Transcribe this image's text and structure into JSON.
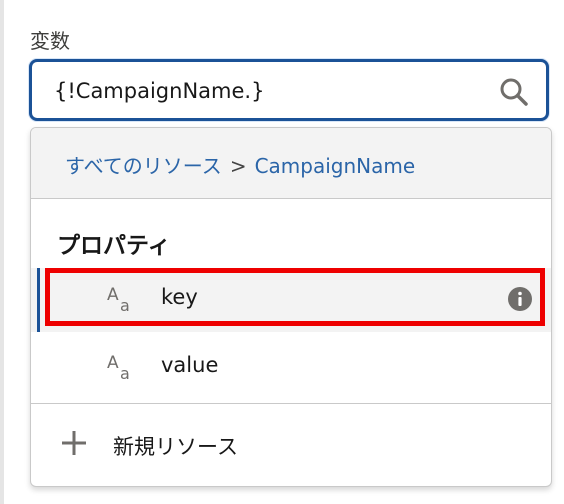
{
  "field": {
    "label": "変数",
    "value": "{!CampaignName.}"
  },
  "icons": {
    "search": "search-icon",
    "text_type": "text-type-icon",
    "info": "info-icon",
    "add": "plus-icon"
  },
  "breadcrumb": {
    "root": "すべてのリソース",
    "separator": ">",
    "current": "CampaignName"
  },
  "section": {
    "heading": "プロパティ"
  },
  "options": [
    {
      "label": "key"
    },
    {
      "label": "value"
    }
  ],
  "footer": {
    "new_resource_label": "新規リソース"
  },
  "colors": {
    "link": "#2b65a8",
    "focus_border": "#1b5297",
    "highlight": "#ee0000",
    "hover_background": "#f3f3f3"
  }
}
